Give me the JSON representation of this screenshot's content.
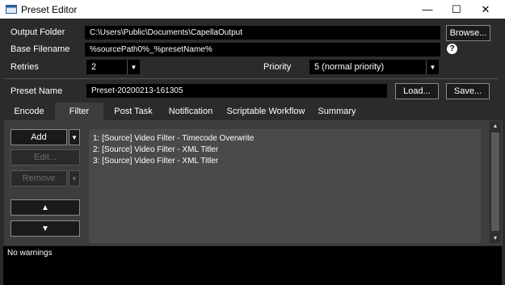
{
  "window": {
    "title": "Preset Editor",
    "controls": {
      "minimize": "—",
      "maximize": "☐",
      "close": "✕"
    }
  },
  "form": {
    "output_folder": {
      "label": "Output Folder",
      "value": "C:\\Users\\Public\\Documents\\CapellaOutput",
      "browse_label": "Browse..."
    },
    "base_filename": {
      "label": "Base Filename",
      "value": "%sourcePath0%_%presetName%",
      "help_icon": "?"
    },
    "retries": {
      "label": "Retries",
      "value": "2"
    },
    "priority": {
      "label": "Priority",
      "value": "5 (normal priority)"
    },
    "preset_name": {
      "label": "Preset Name",
      "value": "Preset-20200213-161305",
      "load_label": "Load...",
      "save_label": "Save..."
    }
  },
  "tabs": [
    "Encode",
    "Filter",
    "Post Task",
    "Notification",
    "Scriptable Workflow",
    "Summary"
  ],
  "active_tab": "Filter",
  "filter_panel": {
    "add_label": "Add",
    "edit_label": "Edit...",
    "remove_label": "Remove",
    "move_up": "▲",
    "move_down": "▼",
    "items": [
      "1: [Source] Video Filter - Timecode Overwrite",
      "2: [Source] Video Filter - XML Titler",
      "3: [Source] Video Filter - XML Titler"
    ]
  },
  "warnings": {
    "text": "No warnings"
  },
  "colors": {
    "background": "#2b2b2b",
    "panel": "#3d3d3d",
    "field": "#000000",
    "list": "#4a4a4a"
  }
}
